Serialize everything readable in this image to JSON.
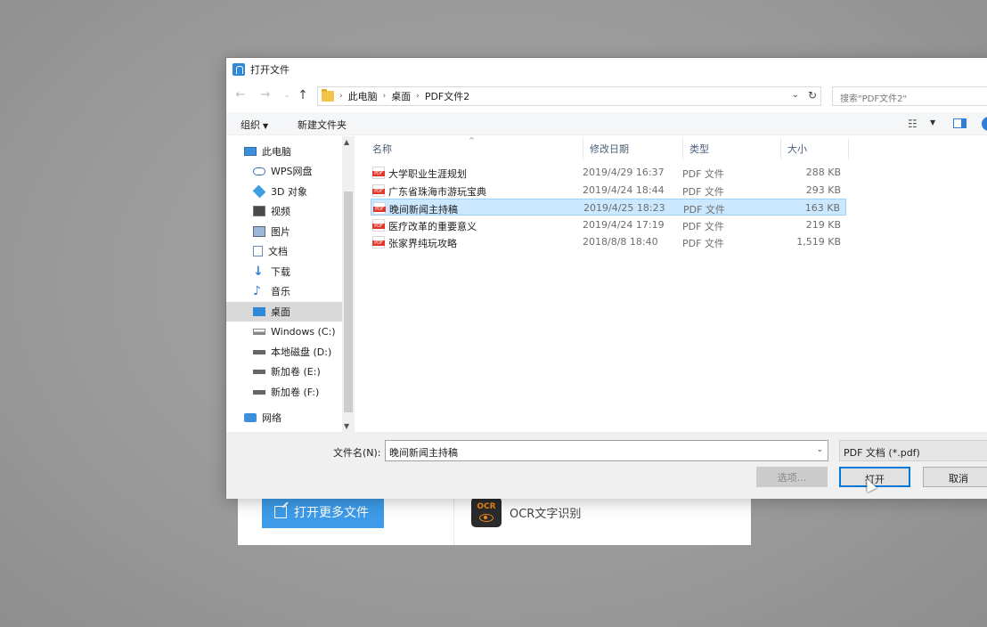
{
  "background_app": {
    "open_more_label": "打开更多文件",
    "ocr_badge": "OCR",
    "ocr_label": "OCR文字识别"
  },
  "dialog": {
    "title": "打开文件",
    "address": {
      "crumbs": [
        "此电脑",
        "桌面",
        "PDF文件2"
      ]
    },
    "search_placeholder": "搜索\"PDF文件2\"",
    "toolbar": {
      "organize": "组织",
      "new_folder": "新建文件夹"
    },
    "nav_items": [
      {
        "label": "此电脑",
        "icon": "computer-icon"
      },
      {
        "label": "WPS网盘",
        "icon": "cloud-icon"
      },
      {
        "label": "3D 对象",
        "icon": "3d-object-icon"
      },
      {
        "label": "视频",
        "icon": "video-icon"
      },
      {
        "label": "图片",
        "icon": "picture-icon"
      },
      {
        "label": "文档",
        "icon": "document-icon"
      },
      {
        "label": "下载",
        "icon": "download-icon"
      },
      {
        "label": "音乐",
        "icon": "music-icon"
      },
      {
        "label": "桌面",
        "icon": "desktop-icon",
        "selected": true
      },
      {
        "label": "Windows (C:)",
        "icon": "drive-icon"
      },
      {
        "label": "本地磁盘 (D:)",
        "icon": "drive-icon"
      },
      {
        "label": "新加卷 (E:)",
        "icon": "drive-icon"
      },
      {
        "label": "新加卷 (F:)",
        "icon": "drive-icon"
      },
      {
        "label": "网络",
        "icon": "network-icon"
      }
    ],
    "columns": {
      "name": "名称",
      "modified": "修改日期",
      "type": "类型",
      "size": "大小"
    },
    "files": [
      {
        "name": "大学职业生涯规划",
        "modified": "2019/4/29 16:37",
        "type": "PDF 文件",
        "size": "288 KB"
      },
      {
        "name": "广东省珠海市游玩宝典",
        "modified": "2019/4/24 18:44",
        "type": "PDF 文件",
        "size": "293 KB"
      },
      {
        "name": "晚间新闻主持稿",
        "modified": "2019/4/25 18:23",
        "type": "PDF 文件",
        "size": "163 KB",
        "selected": true
      },
      {
        "name": "医疗改革的重要意义",
        "modified": "2019/4/24 17:19",
        "type": "PDF 文件",
        "size": "219 KB"
      },
      {
        "name": "张家界纯玩攻略",
        "modified": "2018/8/8 18:40",
        "type": "PDF 文件",
        "size": "1,519 KB"
      }
    ],
    "filename_label": "文件名(N):",
    "filename_value": "晚间新闻主持稿",
    "filetype_value": "PDF 文档 (*.pdf)",
    "buttons": {
      "options": "选项...",
      "open": "打开",
      "cancel": "取消"
    }
  }
}
